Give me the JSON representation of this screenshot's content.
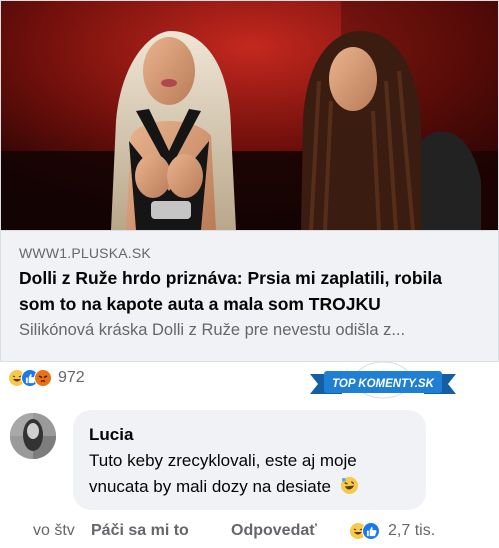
{
  "post": {
    "image_alt_icon": "video-thumbnail-two-women",
    "link": {
      "domain": "WWW1.PLUSKA.SK",
      "title": "Dolli z Ruže hrdo priznáva: Prsia mi zaplatili, robila som to na kapote auta a mala som TROJKU",
      "description": "Silikónová kráska Dolli z Ruže pre nevestu odišla z..."
    },
    "reactions": {
      "icons": [
        "haha-reaction-icon",
        "like-reaction-icon",
        "angry-reaction-icon"
      ],
      "count": "972"
    }
  },
  "badge": {
    "text": "TOP KOMENTY.SK",
    "color": "#1f7fd3"
  },
  "comment": {
    "author": "Lucia",
    "text": "Tuto keby zrecyklovali, este aj moje vnucata by mali dozy na desiate",
    "emoji": "🤣",
    "time": "vo štv",
    "like_label": "Páči sa mi to",
    "reply_label": "Odpovedať",
    "reaction_icons": [
      "haha-reaction-icon",
      "like-reaction-icon"
    ],
    "reaction_count": "2,7 tis."
  },
  "colors": {
    "like_blue": "#1877f2",
    "haha_yellow": "#f7c94a",
    "angry_orange": "#e9710f",
    "secondary_text": "#65676b",
    "bubble_bg": "#f0f2f5"
  }
}
